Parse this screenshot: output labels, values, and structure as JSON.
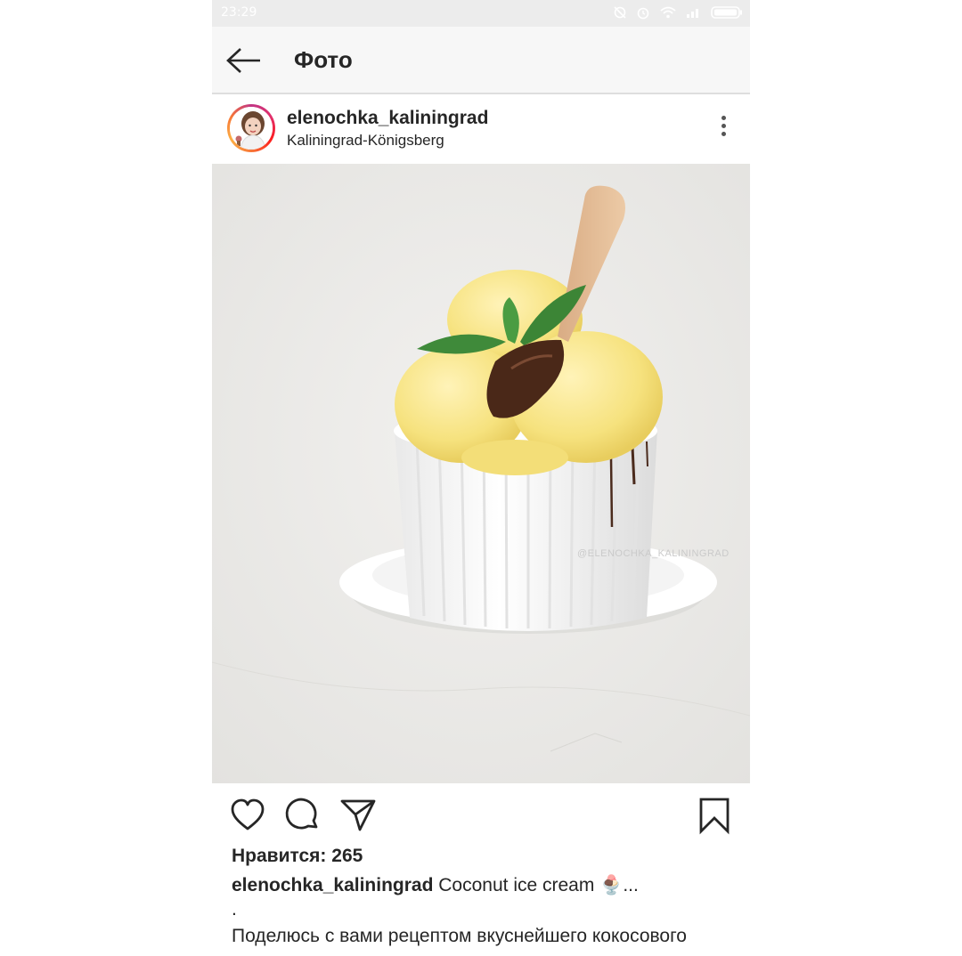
{
  "status_bar": {
    "time": "23:29",
    "icons": [
      "sync-off-icon",
      "alarm-icon",
      "wifi-icon",
      "signal-icon",
      "battery-icon"
    ]
  },
  "header": {
    "title": "Фото",
    "back_icon": "arrow-left-icon"
  },
  "post": {
    "username": "elenochka_kaliningrad",
    "location": "Kaliningrad-Königsberg",
    "more_icon": "vertical-dots-icon",
    "image_watermark": "@ELENOCHKA_KALININGRAD",
    "likes_text": "Нравится: 265",
    "caption_user": "elenochka_kaliningrad",
    "caption_text": "Coconut ice cream",
    "caption_emoji": "🍨",
    "caption_ellipsis": "...",
    "caption_dot": ".",
    "caption_line2": "Поделюсь с вами рецептом вкуснейшего кокосового"
  },
  "actions": {
    "icons": [
      "heart-icon",
      "comment-icon",
      "share-icon",
      "bookmark-icon"
    ]
  },
  "colors": {
    "text": "#262626",
    "status_bar_bg": "#ececec",
    "header_bg": "#f7f7f7",
    "photo_bg": "#ecebe9",
    "avatar_ring": "#e1306c"
  }
}
